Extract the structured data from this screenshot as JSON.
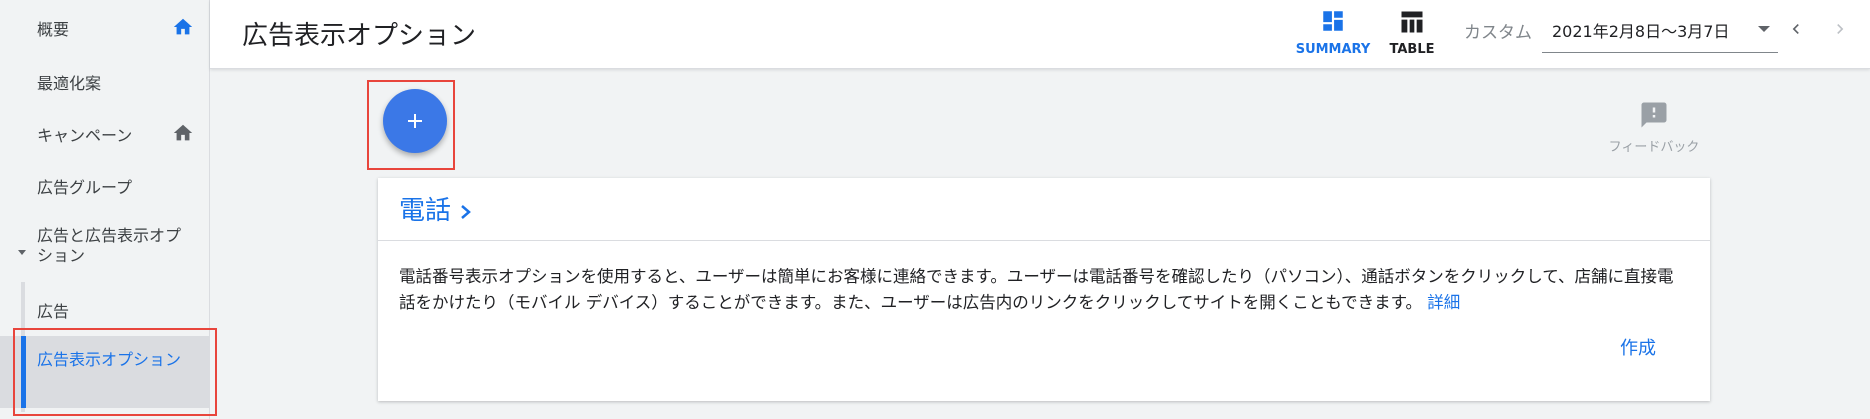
{
  "sidebar": {
    "items": [
      {
        "label": "概要",
        "icon": "home-icon"
      },
      {
        "label": "最適化案"
      },
      {
        "label": "キャンペーン",
        "icon": "home-icon"
      },
      {
        "label": "広告グループ"
      },
      {
        "label": "広告と広告表示オプション"
      },
      {
        "label": "広告"
      },
      {
        "label": "広告表示オプション"
      }
    ]
  },
  "header": {
    "title": "広告表示オプション",
    "summary_label": "SUMMARY",
    "table_label": "TABLE",
    "date_label": "カスタム",
    "date_range": "2021年2月8日〜3月7日"
  },
  "fab": {
    "icon": "plus-icon"
  },
  "feedback": {
    "label": "フィードバック",
    "icon": "feedback-icon"
  },
  "card": {
    "title": "電話",
    "description": "電話番号表示オプションを使用すると、ユーザーは簡単にお客様に連絡できます。ユーザーは電話番号を確認したり（パソコン）、通話ボタンをクリックして、店舗に直接電話をかけたり（モバイル デバイス）することができます。また、ユーザーは広告内のリンクをクリックしてサイトを開くこともできます。",
    "details_link": "詳細",
    "create_label": "作成"
  },
  "colors": {
    "accent": "#1a73e8",
    "fab": "#3b78e7",
    "highlight_box": "#e8453c"
  }
}
